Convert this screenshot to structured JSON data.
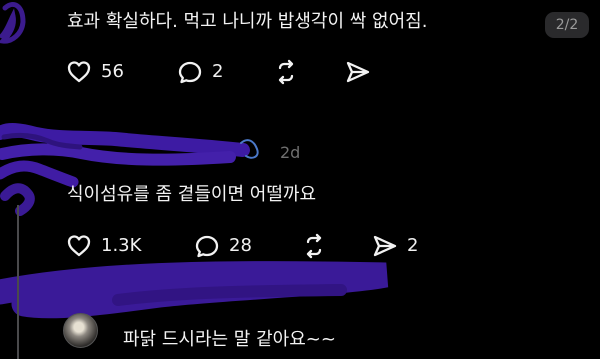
{
  "top_comment": {
    "text": "효과 확실하다. 먹고 나니까 밥생각이 싹 없어짐.",
    "page_badge": "2/2",
    "likes": "56",
    "comments": "2"
  },
  "reply_1": {
    "timestamp": "2d",
    "text": "식이섬유를 좀 곁들이면 어떨까요",
    "likes": "1.3K",
    "comments": "28",
    "shares": "2"
  },
  "reply_2": {
    "text": "파닭 드시라는 말 같아요~~"
  },
  "icons": {
    "like": "heart-icon",
    "comment": "comment-bubble-icon",
    "repost": "repost-icon",
    "share": "send-icon"
  },
  "colors": {
    "background": "#000000",
    "text": "#f2f2f2",
    "muted": "#9a9a9a",
    "redaction_purple": "#3c1ba0",
    "badge": "#2a2a2c"
  }
}
